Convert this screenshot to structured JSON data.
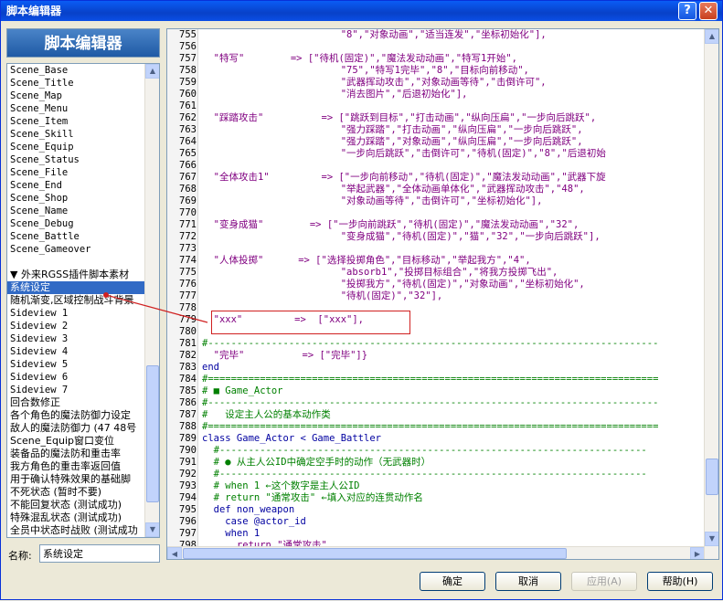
{
  "window": {
    "title": "脚本编辑器",
    "help_glyph": "?",
    "close_glyph": "✕"
  },
  "sidebar": {
    "header": "脚本编辑器",
    "items": [
      {
        "label": "Scene_Base",
        "mono": true
      },
      {
        "label": "Scene_Title",
        "mono": true
      },
      {
        "label": "Scene_Map",
        "mono": true
      },
      {
        "label": "Scene_Menu",
        "mono": true
      },
      {
        "label": "Scene_Item",
        "mono": true
      },
      {
        "label": "Scene_Skill",
        "mono": true
      },
      {
        "label": "Scene_Equip",
        "mono": true
      },
      {
        "label": "Scene_Status",
        "mono": true
      },
      {
        "label": "Scene_File",
        "mono": true
      },
      {
        "label": "Scene_End",
        "mono": true
      },
      {
        "label": "Scene_Shop",
        "mono": true
      },
      {
        "label": "Scene_Name",
        "mono": true
      },
      {
        "label": "Scene_Debug",
        "mono": true
      },
      {
        "label": "Scene_Battle",
        "mono": true
      },
      {
        "label": "Scene_Gameover",
        "mono": true
      },
      {
        "label": "",
        "gap": true
      },
      {
        "label": "▼ 外来RGSS插件脚本素材",
        "mono": false
      },
      {
        "label": "系统设定",
        "mono": false,
        "selected": true
      },
      {
        "label": "随机渐变,区域控制战斗背景",
        "mono": false
      },
      {
        "label": "Sideview 1",
        "mono": true
      },
      {
        "label": "Sideview 2",
        "mono": true
      },
      {
        "label": "Sideview 3",
        "mono": true
      },
      {
        "label": "Sideview 4",
        "mono": true
      },
      {
        "label": "Sideview 5",
        "mono": true
      },
      {
        "label": "Sideview 6",
        "mono": true
      },
      {
        "label": "Sideview 7",
        "mono": true
      },
      {
        "label": "回合数修正",
        "mono": false
      },
      {
        "label": "各个角色的魔法防御力设定",
        "mono": false
      },
      {
        "label": "敌人的魔法防御力 (47 48号",
        "mono": false
      },
      {
        "label": "Scene_Equip窗口变位",
        "mono": false
      },
      {
        "label": "装备品的魔法防和重击率",
        "mono": false
      },
      {
        "label": "我方角色的重击率返回值",
        "mono": false
      },
      {
        "label": "用于确认特殊效果的基础脚",
        "mono": false
      },
      {
        "label": "不死状态 (暂时不要)",
        "mono": false
      },
      {
        "label": "不能回复状态 (测试成功)",
        "mono": false
      },
      {
        "label": "特殊混乱状态 (测试成功)",
        "mono": false
      },
      {
        "label": "全员中状态时战败 (测试成功",
        "mono": false
      }
    ],
    "name_label": "名称:",
    "name_value": "系统设定"
  },
  "editor": {
    "lines": [
      {
        "n": "755",
        "t": "                        \"8\",\"对象动画\",\"适当连发\",\"坐标初始化\"],",
        "cls": "s"
      },
      {
        "n": "756",
        "t": "",
        "cls": "p"
      },
      {
        "n": "757",
        "t": "  \"特写\"        => [\"待机(固定)\",\"魔法发动动画\",\"特写1开始\",",
        "cls": "s"
      },
      {
        "n": "758",
        "t": "                        \"75\",\"特写1完毕\",\"8\",\"目标向前移动\",",
        "cls": "s"
      },
      {
        "n": "759",
        "t": "                        \"武器挥动攻击\",\"对象动画等待\",\"击倒许可\",",
        "cls": "s"
      },
      {
        "n": "760",
        "t": "                        \"消去图片\",\"后退初始化\"],",
        "cls": "s"
      },
      {
        "n": "761",
        "t": "",
        "cls": "p"
      },
      {
        "n": "762",
        "t": "  \"踩踏攻击\"          => [\"跳跃到目标\",\"打击动画\",\"纵向压扁\",\"一步向后跳跃\",",
        "cls": "s"
      },
      {
        "n": "763",
        "t": "                        \"强力踩踏\",\"打击动画\",\"纵向压扁\",\"一步向后跳跃\",",
        "cls": "s"
      },
      {
        "n": "764",
        "t": "                        \"强力踩踏\",\"对象动画\",\"纵向压扁\",\"一步向后跳跃\",",
        "cls": "s"
      },
      {
        "n": "765",
        "t": "                        \"一步向后跳跃\",\"击倒许可\",\"待机(固定)\",\"8\",\"后退初始",
        "cls": "s"
      },
      {
        "n": "766",
        "t": "",
        "cls": "p"
      },
      {
        "n": "767",
        "t": "  \"全体攻击1\"         => [\"一步向前移动\",\"待机(固定)\",\"魔法发动动画\",\"武器下旋",
        "cls": "s"
      },
      {
        "n": "768",
        "t": "                        \"举起武器\",\"全体动画单体化\",\"武器挥动攻击\",\"48\",",
        "cls": "s"
      },
      {
        "n": "769",
        "t": "                        \"对象动画等待\",\"击倒许可\",\"坐标初始化\"],",
        "cls": "s"
      },
      {
        "n": "770",
        "t": "",
        "cls": "p"
      },
      {
        "n": "771",
        "t": "  \"变身成猫\"        => [\"一步向前跳跃\",\"待机(固定)\",\"魔法发动动画\",\"32\",",
        "cls": "s"
      },
      {
        "n": "772",
        "t": "                        \"变身成猫\",\"待机(固定)\",\"猫\",\"32\",\"一步向后跳跃\"],",
        "cls": "s"
      },
      {
        "n": "773",
        "t": "",
        "cls": "p"
      },
      {
        "n": "774",
        "t": "  \"人体投掷\"      => [\"选择投掷角色\",\"目标移动\",\"举起我方\",\"4\",",
        "cls": "s"
      },
      {
        "n": "775",
        "t": "                        \"absorb1\",\"投掷目标组合\",\"将我方投掷飞出\",",
        "cls": "s"
      },
      {
        "n": "776",
        "t": "                        \"投掷我方\",\"待机(固定)\",\"对象动画\",\"坐标初始化\",",
        "cls": "s"
      },
      {
        "n": "777",
        "t": "                        \"待机(固定)\",\"32\"],",
        "cls": "s"
      },
      {
        "n": "778",
        "t": "",
        "cls": "p"
      },
      {
        "n": "779",
        "t": "  \"xxx\"         =>  [\"xxx\"],",
        "cls": "s"
      },
      {
        "n": "780",
        "t": "",
        "cls": "p"
      },
      {
        "n": "781",
        "t": "#------------------------------------------------------------------------------",
        "cls": "c"
      },
      {
        "n": "782",
        "t": "  \"完毕\"          => [\"完毕\"]}",
        "cls": "s"
      },
      {
        "n": "783",
        "t": "end",
        "cls": "k"
      },
      {
        "n": "784",
        "t": "#==============================================================================",
        "cls": "c"
      },
      {
        "n": "785",
        "t": "# ■ Game_Actor",
        "cls": "c"
      },
      {
        "n": "786",
        "t": "#------------------------------------------------------------------------------",
        "cls": "c"
      },
      {
        "n": "787",
        "t": "#   设定主人公的基本动作类",
        "cls": "c"
      },
      {
        "n": "788",
        "t": "#==============================================================================",
        "cls": "c"
      },
      {
        "n": "789",
        "t": "class Game_Actor < Game_Battler",
        "cls": "k"
      },
      {
        "n": "790",
        "t": "  #--------------------------------------------------------------------------",
        "cls": "c"
      },
      {
        "n": "791",
        "t": "  # ● 从主人公ID中确定空手时的动作（无武器时）",
        "cls": "c"
      },
      {
        "n": "792",
        "t": "  #--------------------------------------------------------------------------",
        "cls": "c"
      },
      {
        "n": "793",
        "t": "  # when 1 ←这个数字是主人公ID",
        "cls": "c"
      },
      {
        "n": "794",
        "t": "  # return \"通常攻击\" ←填入对应的连贯动作名",
        "cls": "c"
      },
      {
        "n": "795",
        "t": "  def non_weapon",
        "cls": "k"
      },
      {
        "n": "796",
        "t": "    case @actor_id",
        "cls": "k"
      },
      {
        "n": "797",
        "t": "    when 1",
        "cls": "k"
      },
      {
        "n": "798",
        "t": "      return \"通常攻击\"",
        "cls": "s"
      }
    ]
  },
  "buttons": {
    "ok": "确定",
    "cancel": "取消",
    "apply": "应用(A)",
    "help": "帮助(H)"
  },
  "colors": {
    "title_bar": "#0a5cf5",
    "selection": "#316ac5",
    "string": "#800080",
    "keyword": "#0000a0",
    "comment": "#008000",
    "annotation": "#d02020"
  }
}
